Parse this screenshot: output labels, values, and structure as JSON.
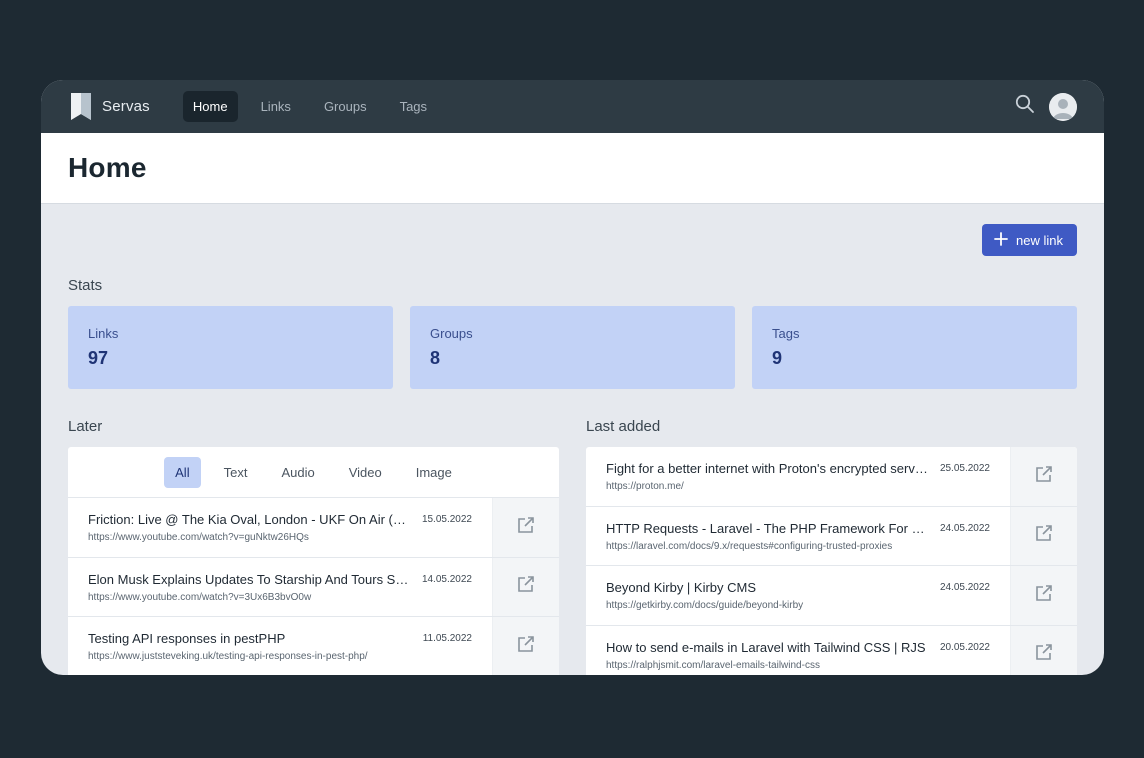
{
  "app": {
    "name": "Servas"
  },
  "nav": {
    "items": [
      {
        "label": "Home",
        "active": true
      },
      {
        "label": "Links",
        "active": false
      },
      {
        "label": "Groups",
        "active": false
      },
      {
        "label": "Tags",
        "active": false
      }
    ],
    "search_icon": "search-icon",
    "avatar_icon": "user-avatar-icon"
  },
  "page": {
    "title": "Home"
  },
  "actions": {
    "new_link_label": "new link"
  },
  "stats": {
    "label": "Stats",
    "cards": [
      {
        "label": "Links",
        "value": "97"
      },
      {
        "label": "Groups",
        "value": "8"
      },
      {
        "label": "Tags",
        "value": "9"
      }
    ]
  },
  "later": {
    "label": "Later",
    "tabs": [
      {
        "label": "All",
        "active": true
      },
      {
        "label": "Text",
        "active": false
      },
      {
        "label": "Audio",
        "active": false
      },
      {
        "label": "Video",
        "active": false
      },
      {
        "label": "Image",
        "active": false
      }
    ],
    "items": [
      {
        "title": "Friction: Live @ The Kia Oval, London - UKF On Air (DJ Set)",
        "url": "https://www.youtube.com/watch?v=guNktw26HQs",
        "date": "15.05.2022"
      },
      {
        "title": "Elon Musk Explains Updates To Starship And Tours Starbase",
        "url": "https://www.youtube.com/watch?v=3Ux6B3bvO0w",
        "date": "14.05.2022"
      },
      {
        "title": "Testing API responses in pestPHP",
        "url": "https://www.juststeveking.uk/testing-api-responses-in-pest-php/",
        "date": "11.05.2022"
      }
    ]
  },
  "last_added": {
    "label": "Last added",
    "items": [
      {
        "title": "Fight for a better internet with Proton's encrypted services",
        "url": "https://proton.me/",
        "date": "25.05.2022"
      },
      {
        "title": "HTTP Requests - Laravel - The PHP Framework For Web Artisans",
        "url": "https://laravel.com/docs/9.x/requests#configuring-trusted-proxies",
        "date": "24.05.2022"
      },
      {
        "title": "Beyond Kirby | Kirby CMS",
        "url": "https://getkirby.com/docs/guide/beyond-kirby",
        "date": "24.05.2022"
      },
      {
        "title": "How to send e-mails in Laravel with Tailwind CSS | RJS",
        "url": "https://ralphjsmit.com/laravel-emails-tailwind-css",
        "date": "20.05.2022"
      }
    ]
  },
  "colors": {
    "background": "#1e2a33",
    "nav": "#2e3b44",
    "accent": "#3f5ac4",
    "stat_card": "#c2d2f6"
  }
}
